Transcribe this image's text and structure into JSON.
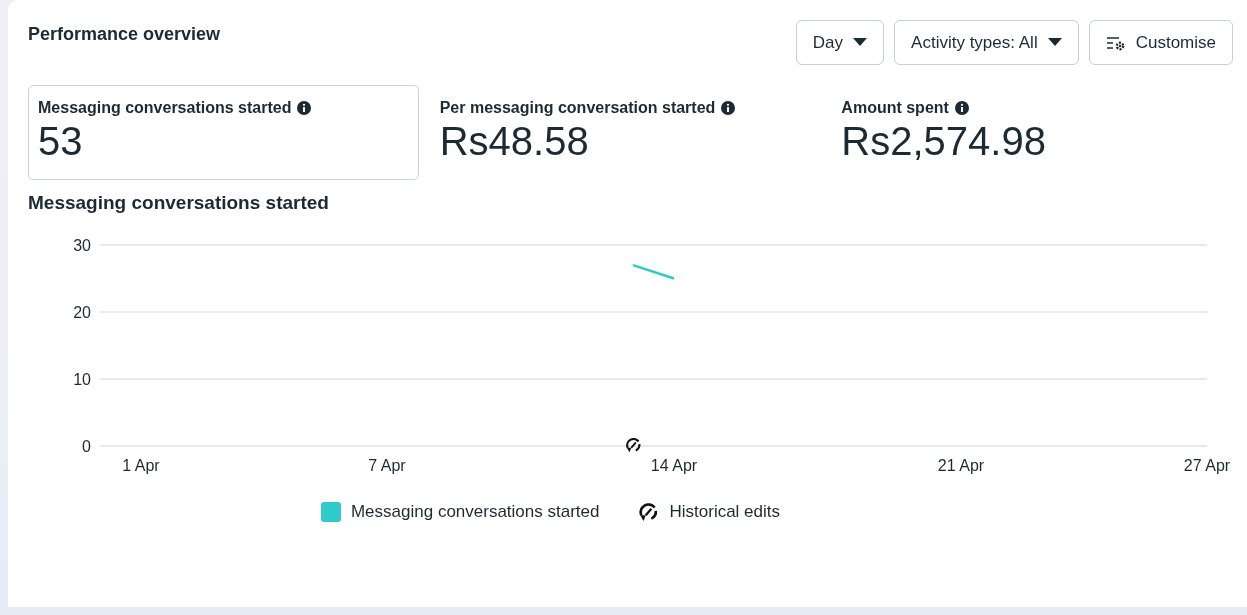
{
  "header": {
    "title": "Performance overview",
    "controls": [
      {
        "kind": "dropdown",
        "label": "Day"
      },
      {
        "kind": "dropdown",
        "label": "Activity types: All"
      },
      {
        "kind": "customise",
        "label": "Customise"
      }
    ]
  },
  "metrics": [
    {
      "label": "Messaging conversations started",
      "value": "53",
      "selected": true
    },
    {
      "label": "Per messaging conversation started",
      "value": "Rs48.58",
      "selected": false
    },
    {
      "label": "Amount spent",
      "value": "Rs2,574.98",
      "selected": false
    }
  ],
  "chart": {
    "title": "Messaging conversations started",
    "edits_legend_label": "Historical edits",
    "chart_data": {
      "type": "line",
      "categories": [
        "1 Apr",
        null,
        null,
        null,
        null,
        null,
        "7 Apr",
        null,
        null,
        null,
        null,
        null,
        null,
        "14 Apr",
        null,
        null,
        null,
        null,
        null,
        null,
        "21 Apr",
        null,
        null,
        null,
        null,
        null,
        "27 Apr"
      ],
      "series": [
        {
          "name": "Messaging conversations started",
          "color": "#2ecbc9",
          "values": [
            null,
            null,
            null,
            null,
            null,
            null,
            null,
            null,
            null,
            null,
            null,
            null,
            27,
            25,
            null,
            null,
            null,
            null,
            null,
            null,
            null,
            null,
            null,
            null,
            null,
            null,
            null
          ]
        }
      ],
      "ylim": [
        0,
        30
      ],
      "yticks": [
        0,
        10,
        20,
        30
      ]
    },
    "days": [
      {
        "edited": false
      },
      {
        "edited": false
      },
      {
        "edited": false
      },
      {
        "edited": false
      },
      {
        "edited": false
      },
      {
        "edited": false
      },
      {
        "edited": false
      },
      {
        "edited": false
      },
      {
        "edited": false
      },
      {
        "edited": false
      },
      {
        "edited": false
      },
      {
        "edited": false
      },
      {
        "edited": true
      },
      {
        "edited": false
      },
      {
        "edited": false
      },
      {
        "edited": false
      },
      {
        "edited": false
      },
      {
        "edited": false
      },
      {
        "edited": false
      },
      {
        "edited": false
      },
      {
        "edited": false
      },
      {
        "edited": false
      },
      {
        "edited": false
      },
      {
        "edited": false
      },
      {
        "edited": false
      },
      {
        "edited": false
      },
      {
        "edited": false
      }
    ]
  }
}
